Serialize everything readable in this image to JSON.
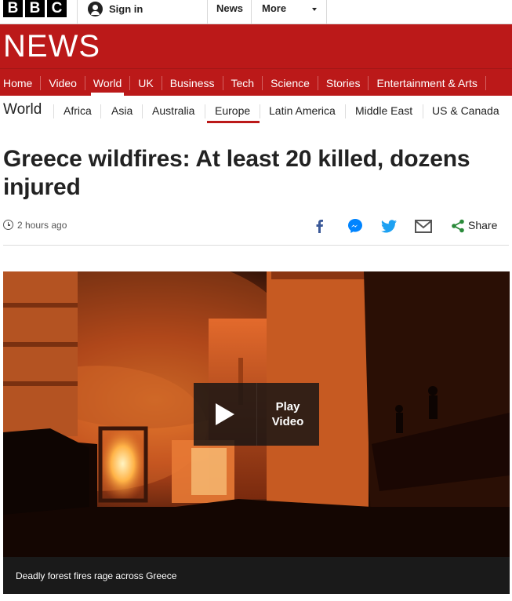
{
  "brand": {
    "logo_letters": [
      "B",
      "B",
      "C"
    ],
    "wordmark": "NEWS",
    "red": "#bb1919"
  },
  "topbar": {
    "signin_label": "Sign in",
    "signin_icon": "user-icon",
    "news_label": "News",
    "more_label": "More",
    "more_icon": "chevron-down-icon"
  },
  "main_nav": {
    "items": [
      {
        "label": "Home",
        "active": false
      },
      {
        "label": "Video",
        "active": false
      },
      {
        "label": "World",
        "active": true
      },
      {
        "label": "UK",
        "active": false
      },
      {
        "label": "Business",
        "active": false
      },
      {
        "label": "Tech",
        "active": false
      },
      {
        "label": "Science",
        "active": false
      },
      {
        "label": "Stories",
        "active": false
      },
      {
        "label": "Entertainment & Arts",
        "active": false
      }
    ]
  },
  "sub_nav": {
    "section": "World",
    "items": [
      {
        "label": "Africa",
        "active": false
      },
      {
        "label": "Asia",
        "active": false
      },
      {
        "label": "Australia",
        "active": false
      },
      {
        "label": "Europe",
        "active": true
      },
      {
        "label": "Latin America",
        "active": false
      },
      {
        "label": "Middle East",
        "active": false
      },
      {
        "label": "US & Canada",
        "active": false
      }
    ]
  },
  "article": {
    "headline": "Greece wildfires: At least 20 killed, dozens injured",
    "timestamp": "2 hours ago",
    "timestamp_icon": "clock-icon"
  },
  "share": {
    "icons": [
      "facebook-icon",
      "messenger-icon",
      "twitter-icon",
      "email-icon",
      "share-icon"
    ],
    "share_label": "Share",
    "colors": {
      "facebook": "#3b5998",
      "messenger": "#0084ff",
      "twitter": "#1da1f2",
      "email": "#555555",
      "share": "#2a8a3a"
    }
  },
  "video": {
    "play_label": "Play Video",
    "play_icon": "play-icon",
    "caption": "Deadly forest fires rage across Greece"
  }
}
